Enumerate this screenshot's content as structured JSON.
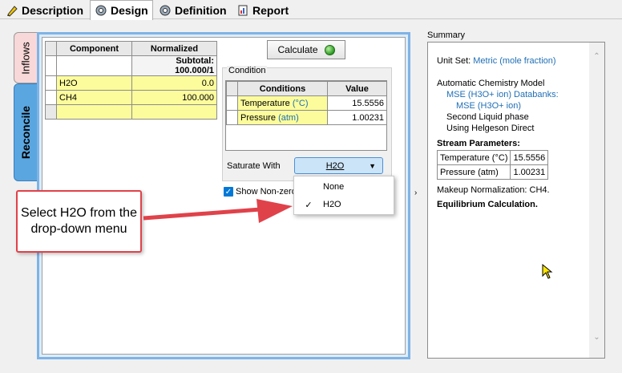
{
  "tabs": [
    {
      "label": "Description",
      "icon": "pencil-icon"
    },
    {
      "label": "Design",
      "icon": "gear-icon"
    },
    {
      "label": "Definition",
      "icon": "gear-icon"
    },
    {
      "label": "Report",
      "icon": "report-icon"
    }
  ],
  "side_tabs": {
    "inflows": "Inflows",
    "reconcile": "Reconcile"
  },
  "component_grid": {
    "headers": [
      "Component",
      "Normalized"
    ],
    "subtotal": "Subtotal: 100.000/1",
    "rows": [
      {
        "component": "H2O",
        "value": "0.0"
      },
      {
        "component": "CH4",
        "value": "100.000"
      },
      {
        "component": "",
        "value": ""
      }
    ]
  },
  "calculate": {
    "label": "Calculate",
    "status_color": "#2a9a20"
  },
  "condition": {
    "group_label": "Condition",
    "headers": [
      "Conditions",
      "Value"
    ],
    "rows": [
      {
        "name": "Temperature",
        "unit": "(°C)",
        "value": "15.5556"
      },
      {
        "name": "Pressure",
        "unit": "(atm)",
        "value": "1.00231"
      }
    ]
  },
  "saturate": {
    "label": "Saturate With",
    "selected": "H2O",
    "options": [
      "None",
      "H2O"
    ],
    "checked_option": "H2O"
  },
  "show_nonzero": {
    "label": "Show Non-zero",
    "checked": true
  },
  "callout": {
    "text": "Select H2O from the drop-down menu"
  },
  "summary": {
    "title": "Summary",
    "unit_set_label": "Unit Set:",
    "unit_set_value": "Metric (mole fraction)",
    "model_title": "Automatic Chemistry Model",
    "databanks": "MSE (H3O+ ion) Databanks:",
    "databank_item": "MSE (H3O+ ion)",
    "second_liquid": "Second Liquid phase",
    "helgeson": "Using Helgeson Direct",
    "stream_params_title": "Stream Parameters:",
    "stream_params": [
      {
        "name": "Temperature (°C)",
        "value": "15.5556"
      },
      {
        "name": "Pressure (atm)",
        "value": "1.00231"
      }
    ],
    "makeup": "Makeup Normalization: CH4.",
    "equilibrium": "Equilibrium Calculation."
  },
  "colors": {
    "accent_blue": "#5aa6e0",
    "callout_red": "#e0424a",
    "yellow_cell": "#fcfc9c"
  }
}
